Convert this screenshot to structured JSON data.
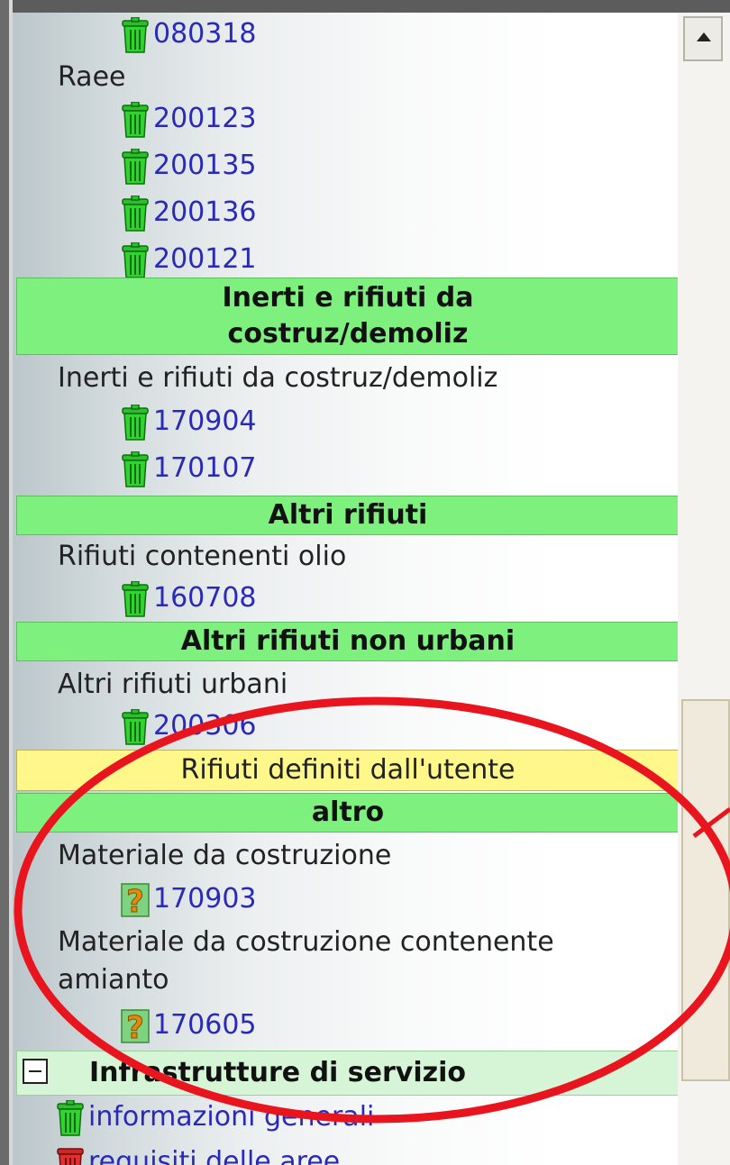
{
  "tree": {
    "top_code": "080318",
    "raee": {
      "label": "Raee",
      "codes": [
        "200123",
        "200135",
        "200136",
        "200121"
      ]
    },
    "inerti_header": {
      "line1": "Inerti e rifiuti da",
      "line2": "costruz/demoliz"
    },
    "inerti_group": {
      "label": "Inerti e rifiuti da costruz/demoliz",
      "codes": [
        "170904",
        "170107"
      ]
    },
    "altri_header": "Altri rifiuti",
    "olio_group": {
      "label": "Rifiuti contenenti olio",
      "codes": [
        "160708"
      ]
    },
    "non_urbani_header": "Altri rifiuti non urbani",
    "urbani_group": {
      "label": "Altri rifiuti urbani",
      "codes": [
        "200306"
      ]
    },
    "user_defined_header": "Rifiuti definiti dall'utente",
    "altro_header": "altro",
    "materiale_group": {
      "label": "Materiale da costruzione",
      "codes": [
        "170903"
      ]
    },
    "amianto_group": {
      "label_line1": "Materiale da costruzione contenente",
      "label_line2": "amianto",
      "codes": [
        "170605"
      ]
    }
  },
  "infrastrutture": {
    "title": "Infrastrutture di servizio",
    "items": [
      "informazioni generali",
      "requisiti delle aree"
    ]
  },
  "colors": {
    "green_header": "#7ef07e",
    "yellow_header": "#fff78a",
    "link": "#2a2ab8",
    "annotation": "#e8141e"
  },
  "icons": {
    "bin_green": "trash-bin-green-icon",
    "bin_red": "trash-bin-red-icon",
    "question": "question-mark-icon"
  }
}
